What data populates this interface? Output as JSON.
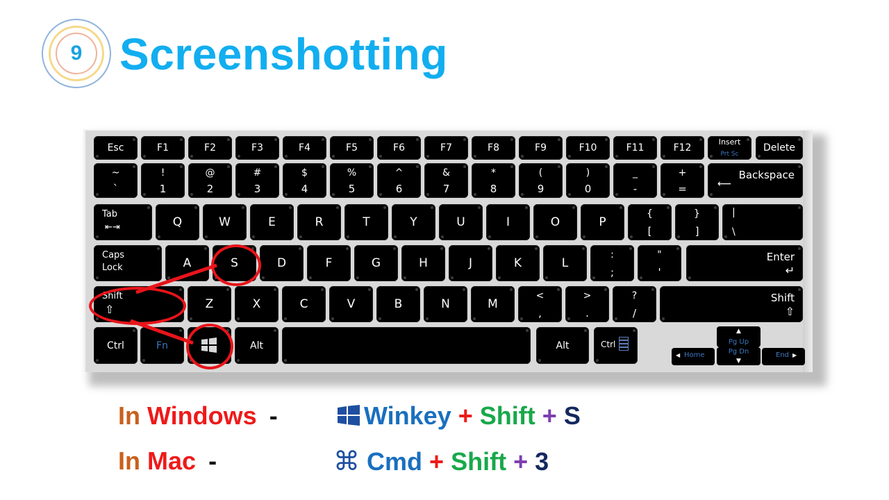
{
  "badge": {
    "number": "9"
  },
  "title": "Screenshotting",
  "keyboard": {
    "row_fn": [
      "Esc",
      "F1",
      "F2",
      "F3",
      "F4",
      "F5",
      "F6",
      "F7",
      "F8",
      "F9",
      "F10",
      "F11",
      "F12"
    ],
    "insert": {
      "top": "Insert",
      "bottom": "Prt Sc"
    },
    "delete": "Delete",
    "row_num": [
      {
        "top": "~",
        "bot": "`"
      },
      {
        "top": "!",
        "bot": "1"
      },
      {
        "top": "@",
        "bot": "2"
      },
      {
        "top": "#",
        "bot": "3"
      },
      {
        "top": "$",
        "bot": "4"
      },
      {
        "top": "%",
        "bot": "5"
      },
      {
        "top": "^",
        "bot": "6"
      },
      {
        "top": "&",
        "bot": "7"
      },
      {
        "top": "*",
        "bot": "8"
      },
      {
        "top": "(",
        "bot": "9"
      },
      {
        "top": ")",
        "bot": "0"
      },
      {
        "top": "_",
        "bot": "-"
      },
      {
        "top": "+",
        "bot": "="
      }
    ],
    "backspace": {
      "label": "Backspace",
      "arrow": "⟵"
    },
    "tab": {
      "label": "Tab",
      "arrow": "⇤⇥"
    },
    "row_q": [
      "Q",
      "W",
      "E",
      "R",
      "T",
      "Y",
      "U",
      "I",
      "O",
      "P"
    ],
    "brackets": [
      {
        "top": "{",
        "bot": "["
      },
      {
        "top": "}",
        "bot": "]"
      }
    ],
    "backslash": {
      "top": "|",
      "bot": "\\"
    },
    "caps": {
      "line1": "Caps",
      "line2": "Lock"
    },
    "row_a": [
      "A",
      "S",
      "D",
      "F",
      "G",
      "H",
      "J",
      "K",
      "L"
    ],
    "semicolon": {
      "top": ":",
      "bot": ";"
    },
    "quote": {
      "top": "\"",
      "bot": "'"
    },
    "enter": {
      "label": "Enter",
      "arrow": "↵"
    },
    "shift_left": {
      "label": "Shift",
      "arrow": "⇧"
    },
    "row_z": [
      "Z",
      "X",
      "C",
      "V",
      "B",
      "N",
      "M"
    ],
    "punct": [
      {
        "top": "<",
        "bot": ","
      },
      {
        "top": ">",
        "bot": "."
      },
      {
        "top": "?",
        "bot": "/"
      }
    ],
    "shift_right": {
      "label": "Shift",
      "arrow": "⇧"
    },
    "ctrl_left": "Ctrl",
    "fn": "Fn",
    "win_icon": "windows-logo",
    "alt_left": "Alt",
    "alt_right": "Alt",
    "ctrl_right": "Ctrl",
    "menu_icon": "menu-icon",
    "pgup": {
      "arrow": "▲",
      "label": "Pg Up"
    },
    "pgdn": {
      "arrow": "▼",
      "label": "Pg Dn"
    },
    "home": {
      "arrow": "◀",
      "label": "Home"
    },
    "end": {
      "arrow": "▶",
      "label": "End"
    },
    "highlighted_keys": [
      "Shift",
      "S",
      "Windows"
    ]
  },
  "shortcuts": {
    "windows": {
      "prefix_in": "In",
      "prefix_os": "Windows",
      "dash": "-",
      "k1": "Winkey",
      "plus1": "+",
      "k2": "Shift",
      "plus2": "+",
      "k3": "S"
    },
    "mac": {
      "prefix_in": "In",
      "prefix_os": "Mac",
      "dash": "-",
      "icon": "⌘",
      "k1": "Cmd",
      "plus1": "+",
      "k2": "Shift",
      "plus2": "+",
      "k3": "3"
    }
  },
  "colors": {
    "title": "#12aef0",
    "highlight": "#e8141a",
    "in": "#c8601e",
    "os": "#ee1a1a",
    "winkey": "#1a6fbf",
    "shift": "#18a84a",
    "plus2": "#7d3fb0",
    "final": "#13295e"
  }
}
